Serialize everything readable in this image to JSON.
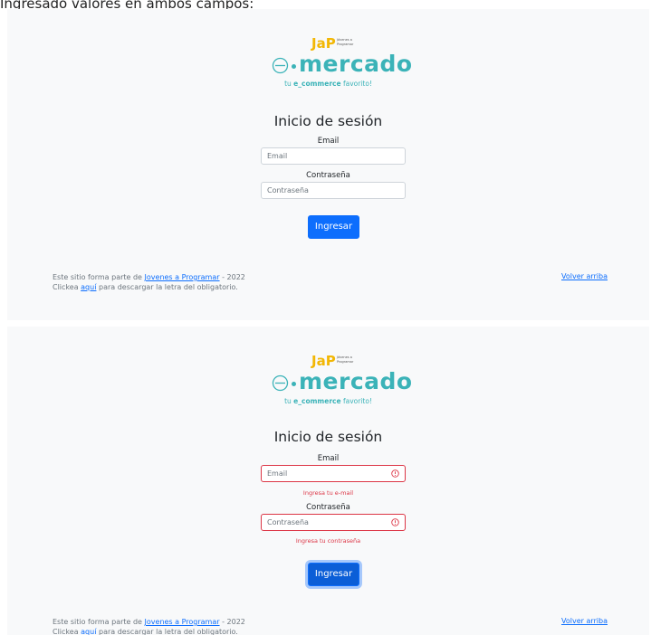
{
  "caption": "Ingresado valores en ambos campos:",
  "logo": {
    "jap_mark": "JaP",
    "jap_text": "Jóvenes a Programar",
    "brand_prefix": "e",
    "brand_name": "mercado",
    "tagline_prefix": "tu",
    "tagline_bold": "e_commerce",
    "tagline_suffix": "favorito!",
    "brand_color": "#3bb3b8"
  },
  "form": {
    "title": "Inicio de sesión",
    "email_label": "Email",
    "email_placeholder": "Email",
    "password_label": "Contraseña",
    "password_placeholder": "Contraseña",
    "submit_label": "Ingresar",
    "email_error": "Ingresa tu e-mail",
    "password_error": "Ingresa tu contraseña"
  },
  "footer": {
    "line1_prefix": "Este sitio forma parte de",
    "line1_link": "Jovenes a Programar",
    "line1_suffix": "- 2022",
    "line2_prefix": "Clickea",
    "line2_link": "aquí",
    "line2_suffix": "para descargar la letra del obligatorio.",
    "back_to_top": "Volver arriba"
  },
  "colors": {
    "primary": "#0d6efd",
    "danger": "#dc3545",
    "panel_bg": "#f8f9fa"
  }
}
